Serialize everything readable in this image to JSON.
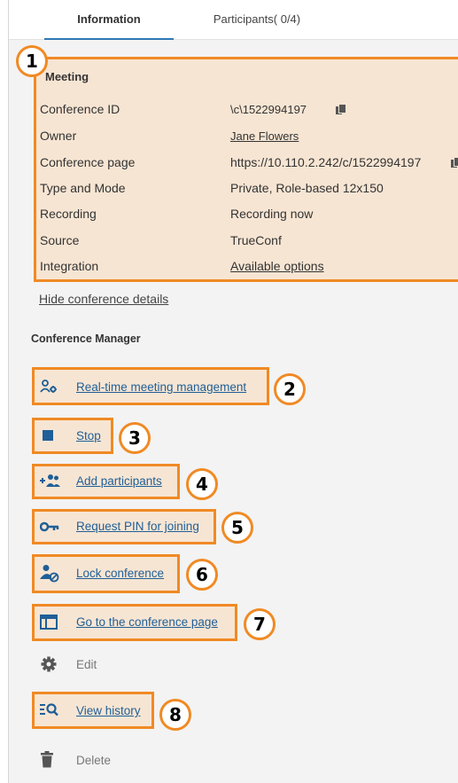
{
  "tabs": [
    {
      "label": "Information",
      "active": true
    },
    {
      "label": "Participants( 0/4)",
      "active": false
    }
  ],
  "meeting": {
    "title": "Meeting",
    "rows": [
      {
        "label": "Conference ID",
        "value": "\\c\\1522994197",
        "copy": true
      },
      {
        "label": "Owner",
        "value": "Jane Flowers",
        "link": true
      },
      {
        "label": "Conference page",
        "value": "https://10.110.2.242/c/1522994197",
        "copy": true
      },
      {
        "label": "Type and Mode",
        "value": "Private, Role-based 12x150"
      },
      {
        "label": "Recording",
        "value": "Recording now"
      },
      {
        "label": "Source",
        "value": "TrueConf"
      },
      {
        "label": "Integration",
        "value": "Available options",
        "link": true
      }
    ],
    "hide_details": "Hide conference details"
  },
  "manager": {
    "title": "Conference Manager",
    "actions": [
      {
        "label": "Real-time meeting management",
        "icon": "people-gear-icon"
      },
      {
        "label": "Stop",
        "icon": "stop-icon"
      },
      {
        "label": "Add participants",
        "icon": "add-participants-icon"
      },
      {
        "label": "Request PIN for joining",
        "icon": "key-icon"
      },
      {
        "label": "Lock conference",
        "icon": "person-block-icon"
      },
      {
        "label": "Go to the conference page",
        "icon": "browser-window-icon"
      },
      {
        "label": "Edit",
        "icon": "gear-icon"
      },
      {
        "label": "View history",
        "icon": "history-search-icon"
      },
      {
        "label": "Delete",
        "icon": "trash-icon"
      }
    ]
  },
  "callouts": [
    "1",
    "2",
    "3",
    "4",
    "5",
    "6",
    "7",
    "8"
  ],
  "colors": {
    "accent": "#f08a24",
    "highlight": "#f7e5d3",
    "link": "#1f5f97",
    "tab_indicator": "#2f78b4"
  }
}
